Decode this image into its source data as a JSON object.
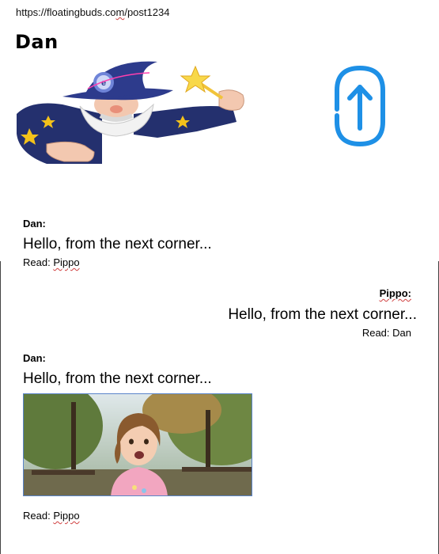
{
  "browser": {
    "url_prefix": "https://floatingbuds.co",
    "url_squiggle": "m",
    "url_suffix": "/post1234"
  },
  "header": {
    "user_name": "Dan"
  },
  "messages": [
    {
      "author": "Dan:",
      "text": "Hello, from the next corner...",
      "read_label": "Read: ",
      "read_by": "Pippo",
      "align": "left"
    },
    {
      "author": "Pippo:",
      "text": "Hello, from the next corner...",
      "read_label": "Read: ",
      "read_by": "Dan",
      "align": "right"
    },
    {
      "author": "Dan:",
      "text": "Hello, from the next corner...",
      "read_label": "Read: ",
      "read_by": "Pippo",
      "align": "left",
      "has_photo": true
    }
  ],
  "icons": {
    "avatar": "wizard-avatar",
    "attach": "paperclip-upload-icon"
  },
  "colors": {
    "accent": "#1e90e6",
    "frame": "#444444",
    "photo_border": "#5a84c9"
  }
}
